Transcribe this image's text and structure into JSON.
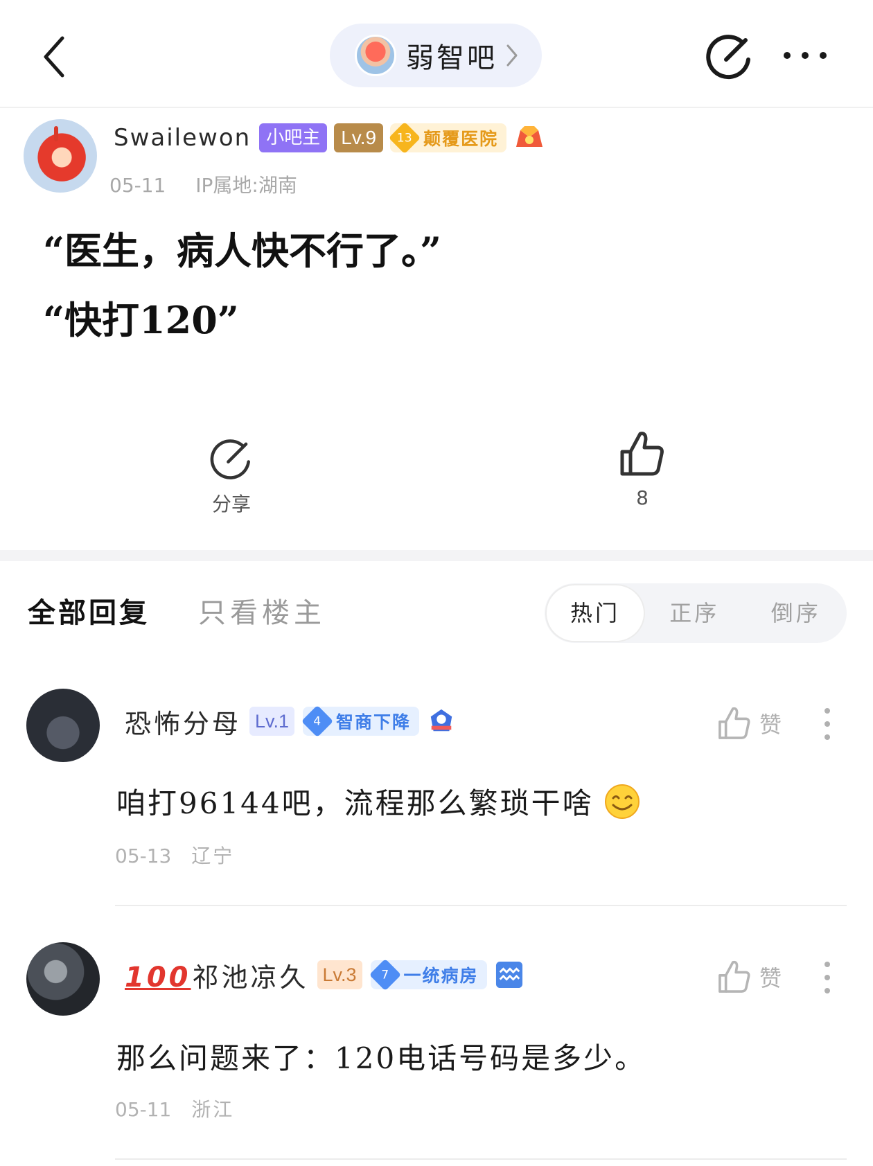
{
  "topbar": {
    "forum_name": "弱智吧"
  },
  "post": {
    "author": "Swailewon",
    "badge_mod": "小吧主",
    "level": "Lv.9",
    "honor_number": "13",
    "honor_title": "颠覆医院",
    "date": "05-11",
    "ip_location": "IP属地:湖南",
    "body_line1": "“医生，病人快不行了。”",
    "body_line2": "“快打120”",
    "share_label": "分享",
    "like_count": "8"
  },
  "reply_tabs": {
    "all": "全部回复",
    "op_only": "只看楼主",
    "sort_hot": "热门",
    "sort_asc": "正序",
    "sort_desc": "倒序"
  },
  "comments": [
    {
      "name": "恐怖分母",
      "level": "Lv.1",
      "honor_number": "4",
      "honor_title": "智商下降",
      "text": "咱打96144吧，流程那么繁琐干啥",
      "date": "05-13",
      "location": "辽宁",
      "like_label": "赞"
    },
    {
      "name_prefix": "100",
      "name": "祁池凉久",
      "level": "Lv.3",
      "honor_number": "7",
      "honor_title": "一统病房",
      "text": "那么问题来了：120电话号码是多少。",
      "date": "05-11",
      "location": "浙江",
      "like_label": "赞"
    }
  ],
  "colors": {
    "mod_badge": "#8f73f5",
    "lv9_badge": "#b88b4a",
    "honor_gold": "#f7b51d",
    "honor_blue": "#4e8df5",
    "forum_pill": "#eef1fb"
  }
}
